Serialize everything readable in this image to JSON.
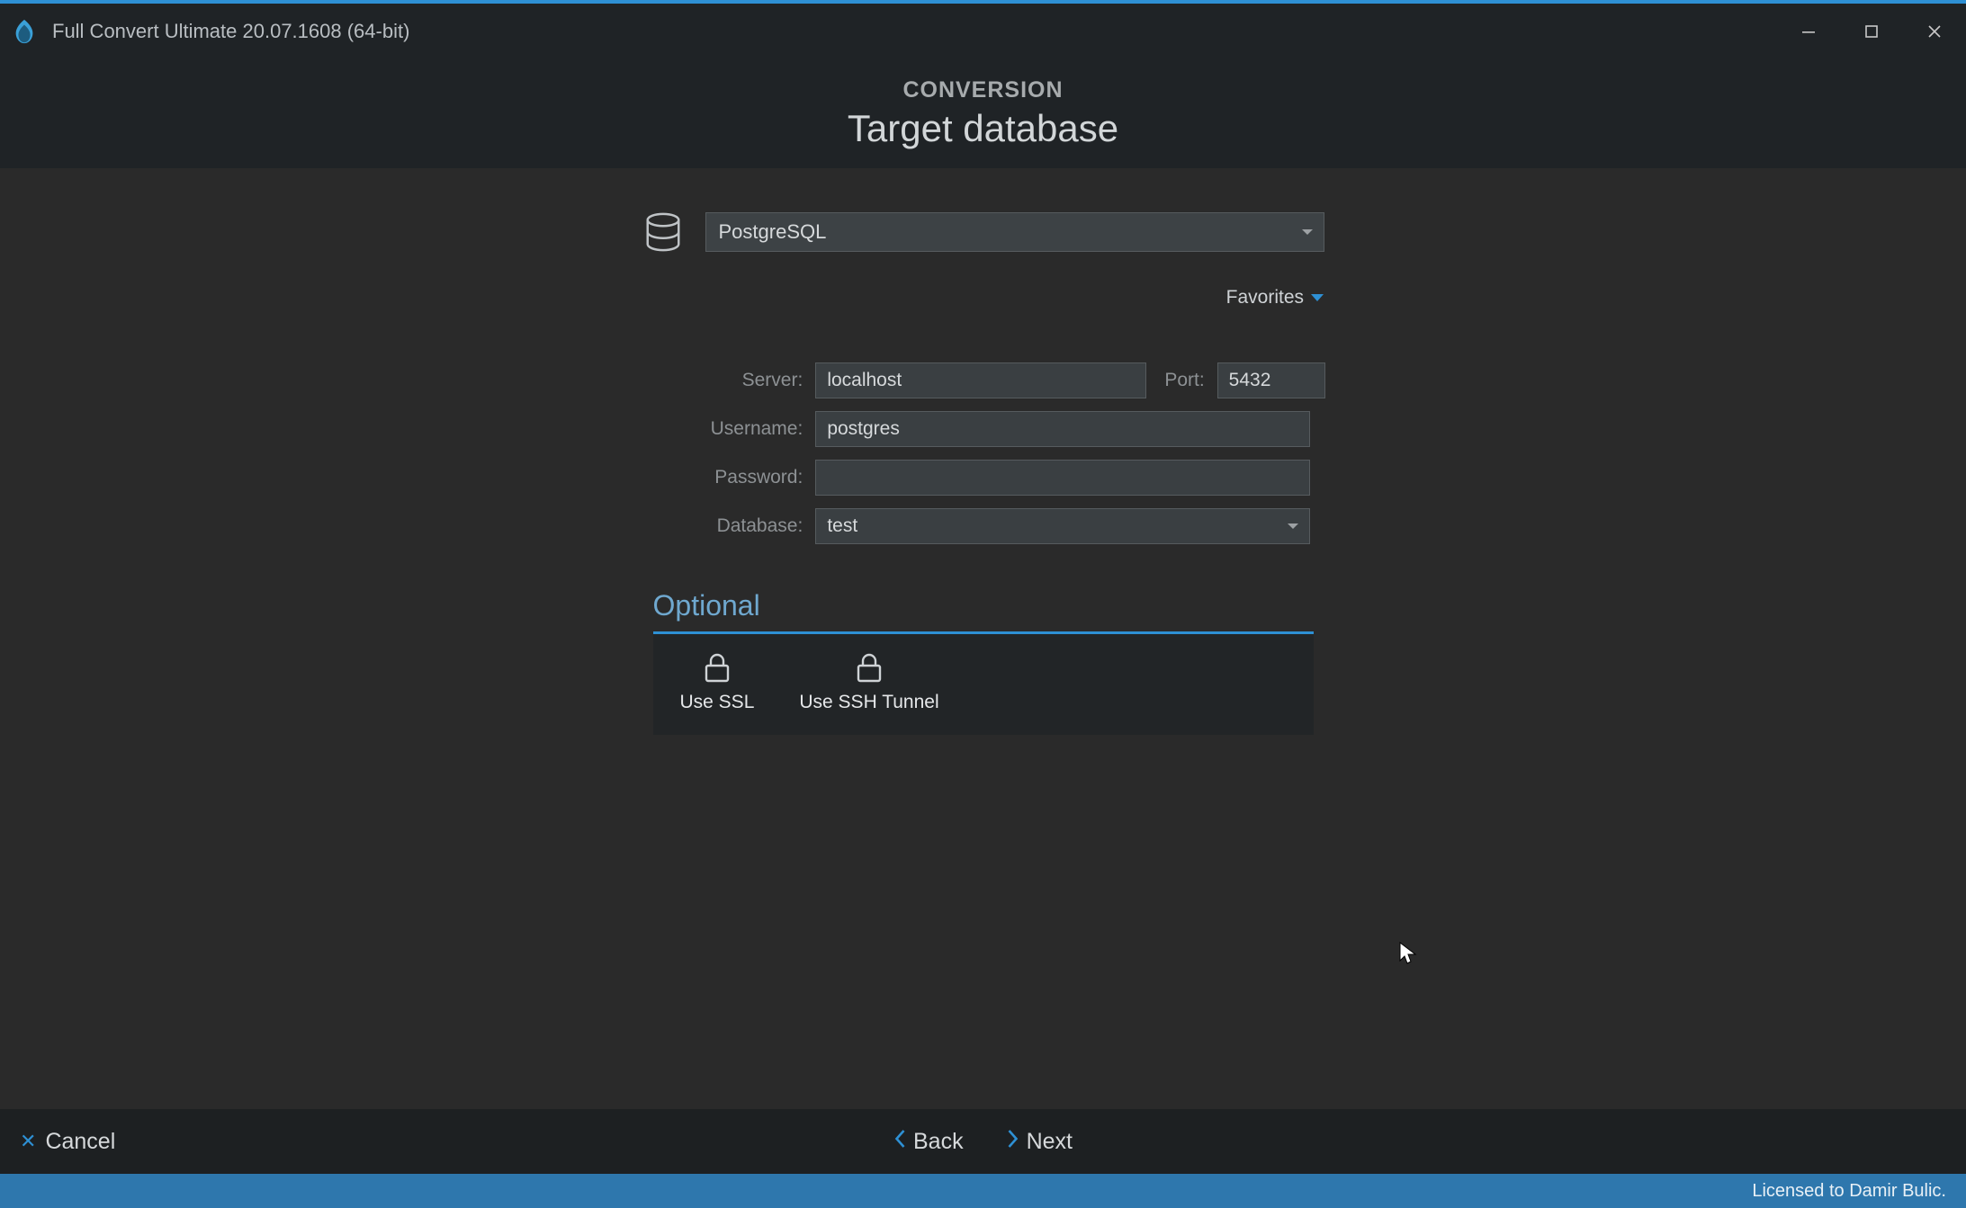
{
  "app": {
    "title": "Full Convert Ultimate 20.07.1608 (64-bit)"
  },
  "header": {
    "label": "CONVERSION",
    "title": "Target database"
  },
  "dbtype": {
    "selected": "PostgreSQL"
  },
  "favorites": {
    "label": "Favorites"
  },
  "form": {
    "server_label": "Server:",
    "server_value": "localhost",
    "port_label": "Port:",
    "port_value": "5432",
    "username_label": "Username:",
    "username_value": "postgres",
    "password_label": "Password:",
    "password_value": "",
    "database_label": "Database:",
    "database_value": "test"
  },
  "optional": {
    "heading": "Optional",
    "use_ssl": "Use SSL",
    "use_ssh": "Use SSH Tunnel"
  },
  "footer": {
    "cancel": "Cancel",
    "back": "Back",
    "next": "Next"
  },
  "status": {
    "license": "Licensed to Damir Bulic."
  }
}
